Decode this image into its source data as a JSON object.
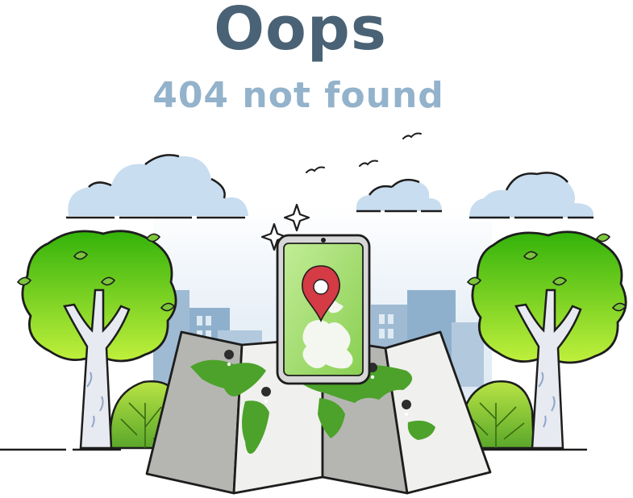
{
  "heading": "Oops",
  "subheading": "404 not found",
  "colors": {
    "heading": "#4a6275",
    "subheading": "#93b2cb",
    "cloud": "#c7dcee",
    "sky": "#e9f1f8",
    "building": "#9db9d1",
    "tree_light": "#b2ea3a",
    "tree_dark": "#3ab80a",
    "trunk": "#e6e8ef",
    "map_panel_light": "#f0f0ee",
    "map_panel_dark": "#b5b6b2",
    "land": "#4ca22a",
    "pin": "#d43b45",
    "outline": "#1d1d1d"
  },
  "icons": [
    "sparkle-icon",
    "bird-icon",
    "location-pin-icon",
    "map-marker-icon",
    "phone-icon"
  ]
}
